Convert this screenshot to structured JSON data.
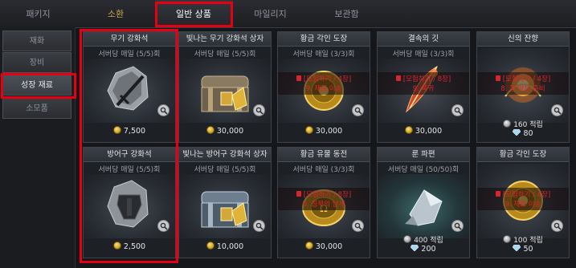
{
  "tabs": [
    {
      "label": "패키지"
    },
    {
      "label": "소환"
    },
    {
      "label": "일반 상품"
    },
    {
      "label": "마일리지"
    },
    {
      "label": "보관함"
    }
  ],
  "sidebar": {
    "items": [
      {
        "label": "재화"
      },
      {
        "label": "장비"
      },
      {
        "label": "성장 재료"
      },
      {
        "label": "소모품"
      }
    ]
  },
  "colors": {
    "highlight": "#e60012",
    "gold_text": "#c9a548",
    "lock_red": "#d9262c"
  },
  "cards": [
    {
      "title": "무기 강화석",
      "limit": "서버당 매일 (5/5)회",
      "price": "7,500",
      "currency": "gold-coin-icon",
      "art": "sword-stone"
    },
    {
      "title": "빛나는 무기 강화석 상자",
      "limit": "서버당 매일 (5/5)회",
      "price": "30,000",
      "currency": "gold-coin-icon",
      "art": "chest"
    },
    {
      "title": "황금 각인 도장",
      "limit": "서버당 매일 (3/3)회",
      "lock1": "[모험하기 / 4장]",
      "lock2": "9. 재료 이송",
      "price": "30,000",
      "currency": "gold-coin-icon",
      "art": "gold-seal"
    },
    {
      "title": "결속의 깃",
      "limit": "서버당 매일 (3/3)회",
      "lock1": "[모험하기 / 8장]",
      "lock2": "9. 폭귀",
      "price": "30,000",
      "currency": "gold-coin-icon",
      "art": "feather"
    },
    {
      "title": "신의 잔향",
      "limit": "",
      "lock1": "[모험하기 / 4장]",
      "lock2": "8. 잘 알든 준비",
      "mileage": "160 적립",
      "gems": "80",
      "art": "orb"
    },
    {
      "title": "방어구 강화석",
      "limit": "서버당 매일 (5/5)회",
      "price": "2,500",
      "currency": "gold-coin-icon",
      "art": "armor-stone"
    },
    {
      "title": "빛나는 방어구 강화석 상자",
      "limit": "서버당 매일 (5/5)회",
      "price": "10,000",
      "currency": "gold-coin-icon",
      "art": "chest-blue"
    },
    {
      "title": "황금 유물 동전",
      "limit": "서버당 매일 (3/3)회",
      "lock1": "[모험하기 / 8장]",
      "lock2": "6. 침묵의 남게",
      "price": "30,000",
      "currency": "gold-coin-icon",
      "art": "gold-coin"
    },
    {
      "title": "룬 파편",
      "limit": "서버당 매일 (50/50)회",
      "mileage": "400 적립",
      "gems": "200",
      "art": "rune-shard"
    },
    {
      "title": "황금 각인 도장",
      "limit": "",
      "lock1": "[모험하기 / 4장]",
      "lock2": "9. 재료 이송",
      "mileage": "100 적립",
      "gems": "50",
      "art": "gold-seal-2"
    }
  ]
}
